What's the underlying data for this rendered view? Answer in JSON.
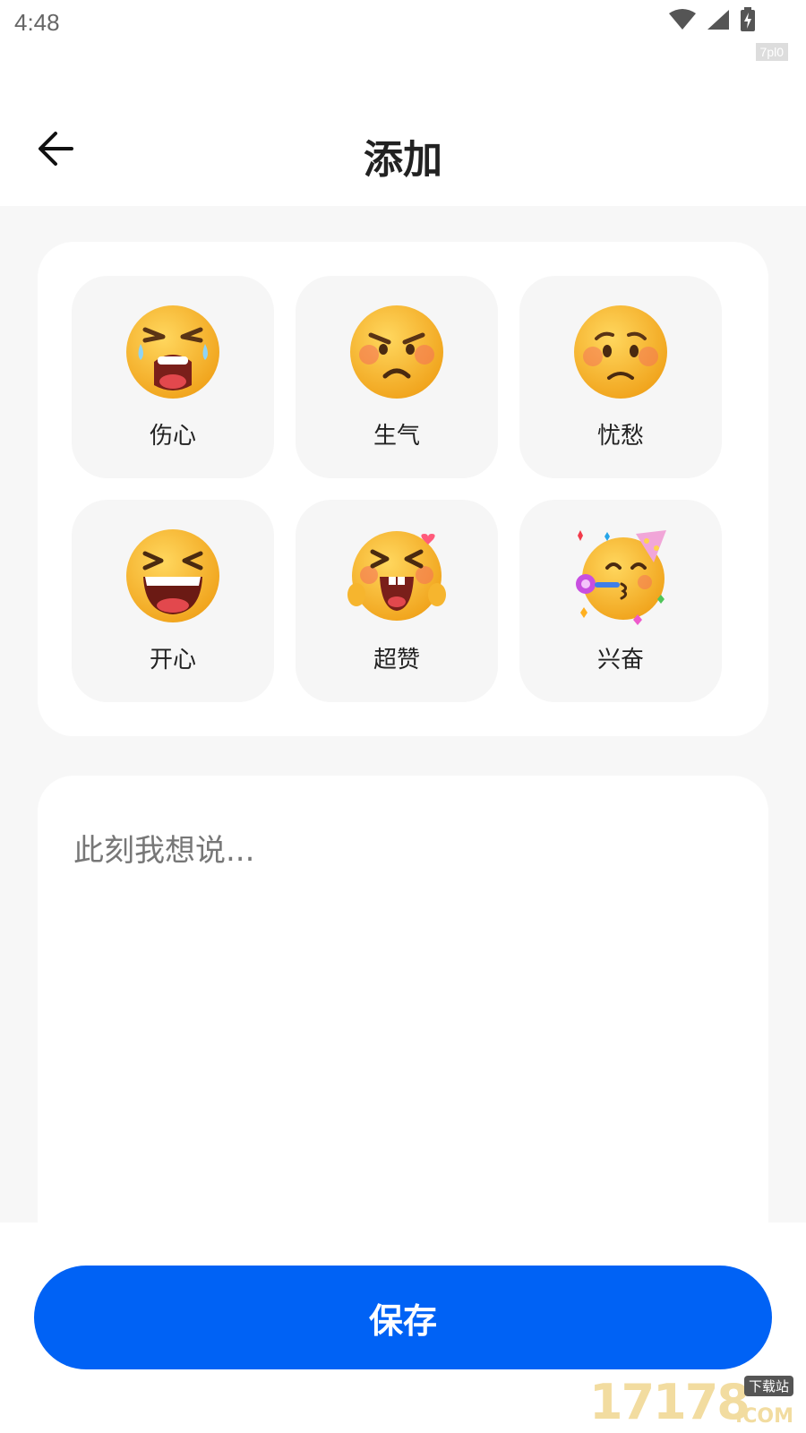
{
  "status_bar": {
    "time": "4:48",
    "tag": "7pl0"
  },
  "header": {
    "title": "添加"
  },
  "moods": [
    {
      "label": "伤心",
      "icon": "crying-face-icon"
    },
    {
      "label": "生气",
      "icon": "angry-face-icon"
    },
    {
      "label": "忧愁",
      "icon": "worried-face-icon"
    },
    {
      "label": "开心",
      "icon": "laughing-face-icon"
    },
    {
      "label": "超赞",
      "icon": "thumbs-up-laughing-face-icon"
    },
    {
      "label": "兴奋",
      "icon": "party-face-icon"
    }
  ],
  "note": {
    "placeholder": "此刻我想说...",
    "value": ""
  },
  "save_button": {
    "label": "保存"
  },
  "watermark": {
    "number": "17178",
    "badge": "下载站",
    "domain": ".COM"
  },
  "colors": {
    "accent": "#0062f5",
    "page_background": "#f7f7f7",
    "tile_background": "#f6f6f6"
  }
}
